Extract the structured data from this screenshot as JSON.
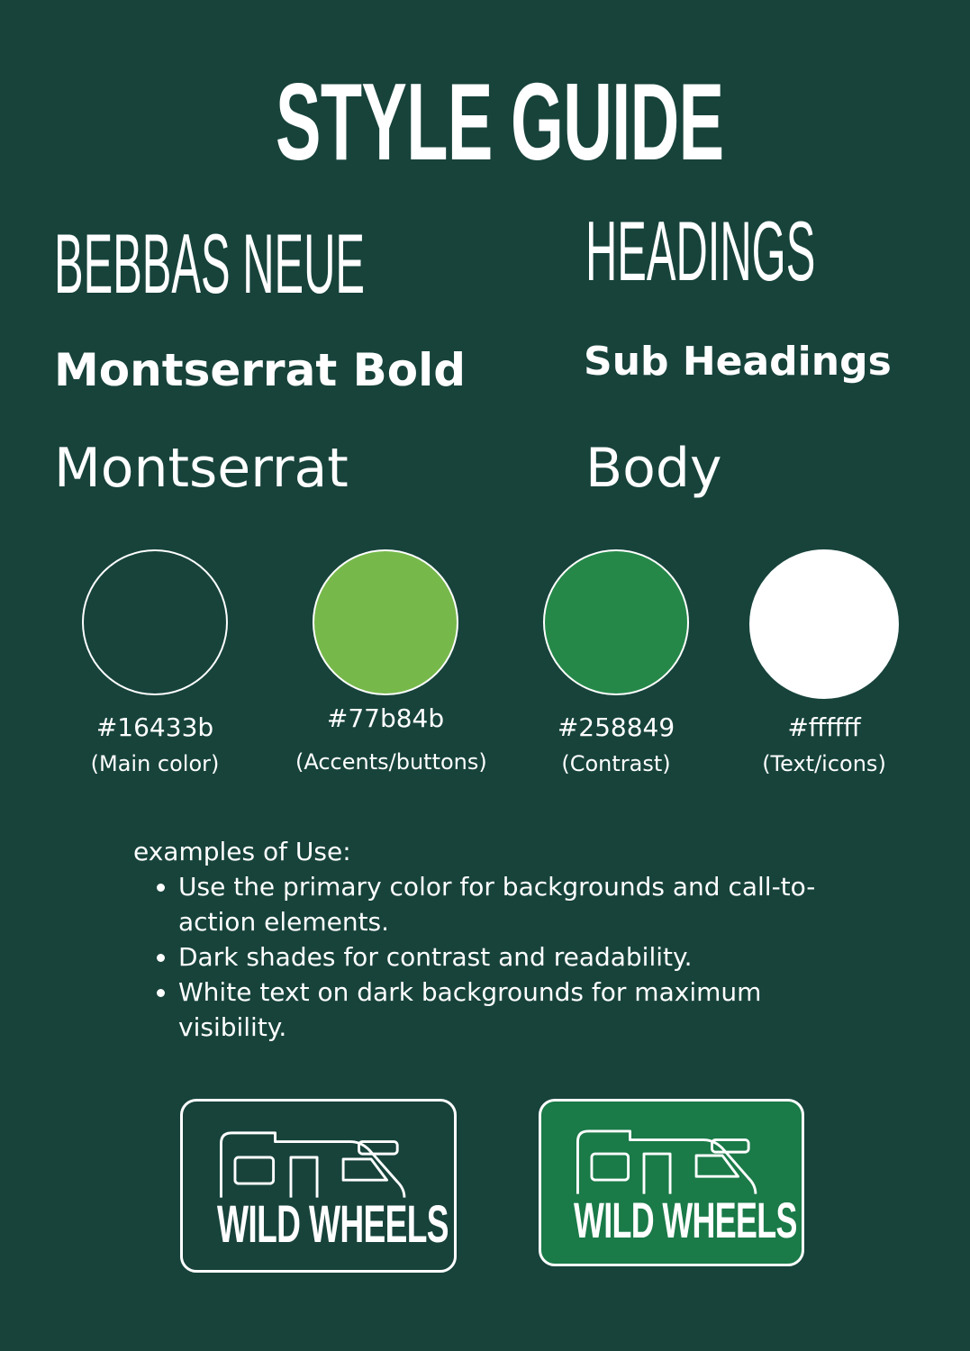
{
  "title": "STYLE GUIDE",
  "typography": {
    "heading_font": "BEBBAS NEUE",
    "heading_sample": "HEADINGS",
    "sub_font": "Montserrat Bold",
    "sub_sample": "Sub Headings",
    "body_font": "Montserrat",
    "body_sample": "Body"
  },
  "colors": [
    {
      "hex": "#16433b",
      "label": "(Main color)",
      "fill": "#17433b"
    },
    {
      "hex": "#77b84b",
      "label": "(Accents/buttons)",
      "fill": "#77b84b"
    },
    {
      "hex": "#258849",
      "label": "(Contrast)",
      "fill": "#258849"
    },
    {
      "hex": "#ffffff",
      "label": "(Text/icons)",
      "fill": "#ffffff"
    }
  ],
  "usage": {
    "intro": "examples of Use:",
    "items": [
      "Use the primary color for backgrounds and call-to-action elements.",
      "Dark shades for contrast and readability.",
      "White text on dark backgrounds for maximum visibility."
    ]
  },
  "logos": [
    {
      "text": "WILD WHEELS",
      "background": "#17433b"
    },
    {
      "text": "WILD WHEELS",
      "background": "#1a7a48"
    }
  ]
}
